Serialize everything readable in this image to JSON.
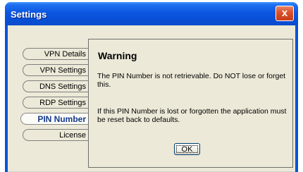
{
  "window": {
    "title": "Settings",
    "close_label": "x"
  },
  "tabs": [
    {
      "label": "VPN Details",
      "active": false
    },
    {
      "label": "VPN Settings",
      "active": false
    },
    {
      "label": "DNS Settings",
      "active": false
    },
    {
      "label": "RDP Settings",
      "active": false
    },
    {
      "label": "PIN Number",
      "active": true
    },
    {
      "label": "License",
      "active": false
    }
  ],
  "dialog": {
    "title": "Warning",
    "message1": "The PIN Number is not retrievable. Do NOT lose or forget this.",
    "message2": "If this PIN Number is lost or forgotten the application must be reset back to defaults.",
    "ok_label": "OK"
  },
  "colors": {
    "titlebar": "#0a53d8",
    "close": "#d9532f",
    "client": "#ece9d8",
    "active_tab_text": "#143a8a"
  }
}
